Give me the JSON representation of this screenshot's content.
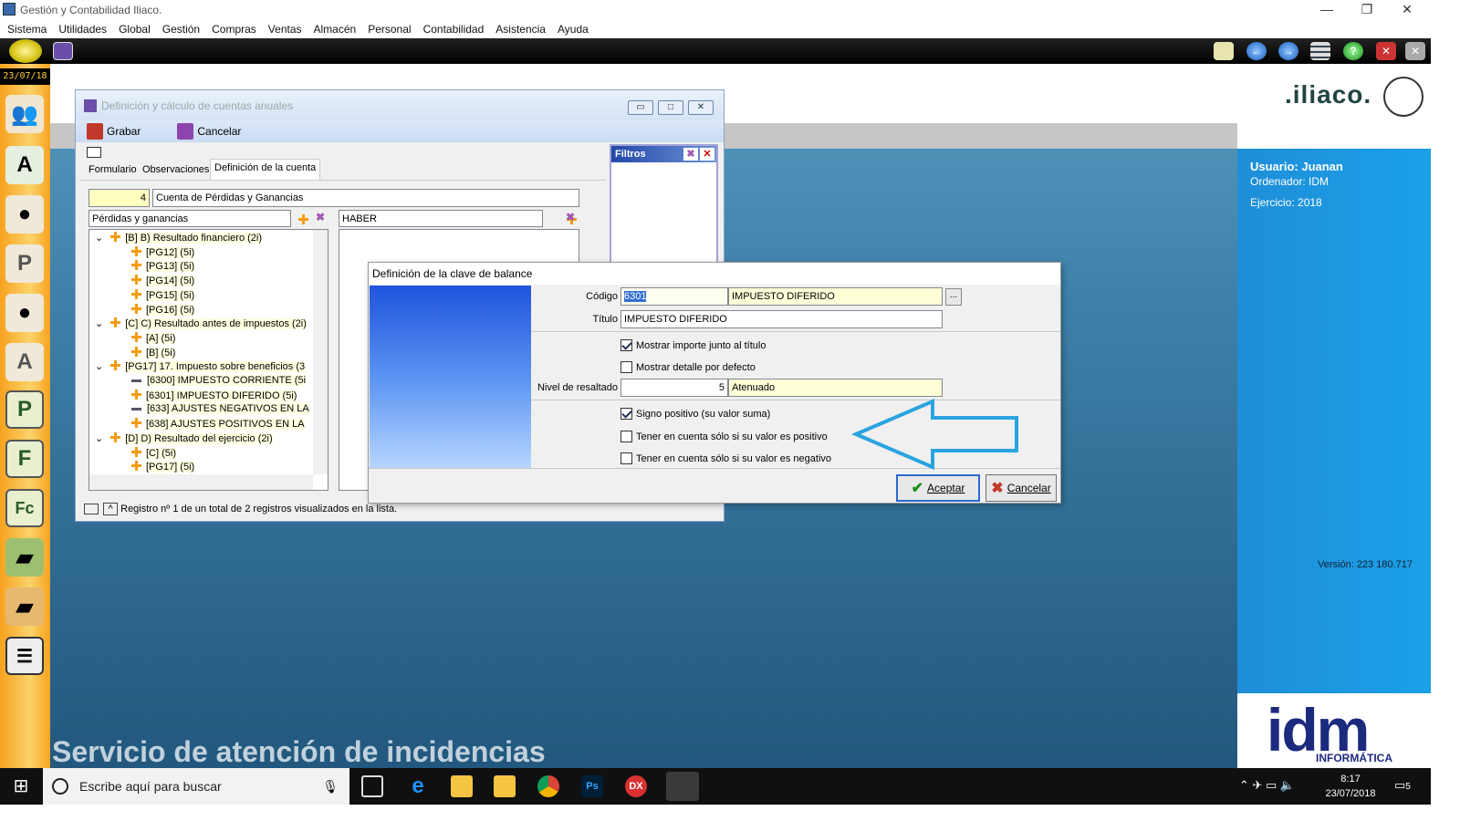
{
  "app": {
    "title": "Gestión y Contabilidad Iliaco.",
    "date": "23/07/18"
  },
  "menu": [
    "Sistema",
    "Utilidades",
    "Global",
    "Gestión",
    "Compras",
    "Ventas",
    "Almacén",
    "Personal",
    "Contabilidad",
    "Asistencia",
    "Ayuda"
  ],
  "window": {
    "title": "Definición y cálculo de cuentas anuales",
    "save_label": "Grabar",
    "cancel_label": "Cancelar",
    "tabs": [
      "Formulario",
      "Observaciones",
      "Definición de la cuenta"
    ],
    "account_number": "4",
    "account_name": "Cuenta de Pérdidas y Ganancias",
    "left_list_title": "Pérdidas y ganancias",
    "right_list_title": "HABER",
    "tree": [
      {
        "t": "[B] B) Resultado financiero (2i)",
        "lvl": 0,
        "icon": "plus",
        "exp": true
      },
      {
        "t": "[PG12] (5i)",
        "lvl": 1,
        "icon": "plus"
      },
      {
        "t": "[PG13] (5i)",
        "lvl": 1,
        "icon": "plus"
      },
      {
        "t": "[PG14] (5i)",
        "lvl": 1,
        "icon": "plus"
      },
      {
        "t": "[PG15] (5i)",
        "lvl": 1,
        "icon": "plus"
      },
      {
        "t": "[PG16] (5i)",
        "lvl": 1,
        "icon": "plus"
      },
      {
        "t": "[C] C) Resultado antes de impuestos (2i)",
        "lvl": 0,
        "icon": "plus",
        "exp": true
      },
      {
        "t": "[A] (5i)",
        "lvl": 1,
        "icon": "plus"
      },
      {
        "t": "[B] (5i)",
        "lvl": 1,
        "icon": "plus"
      },
      {
        "t": "[PG17] 17. Impuesto sobre beneficios (3",
        "lvl": 0,
        "icon": "plus",
        "exp": true
      },
      {
        "t": "[6300] IMPUESTO CORRIENTE (5i",
        "lvl": 1,
        "icon": "minus"
      },
      {
        "t": "[6301] IMPUESTO DIFERIDO (5i)",
        "lvl": 1,
        "icon": "plus"
      },
      {
        "t": "[633] AJUSTES NEGATIVOS EN LA",
        "lvl": 1,
        "icon": "minus"
      },
      {
        "t": "[638] AJUSTES POSITIVOS EN LA",
        "lvl": 1,
        "icon": "plus"
      },
      {
        "t": "[D] D) Resultado del ejercicio (2i)",
        "lvl": 0,
        "icon": "plus",
        "exp": true
      },
      {
        "t": "[C] (5i)",
        "lvl": 1,
        "icon": "plus"
      },
      {
        "t": "[PG17] (5i)",
        "lvl": 1,
        "icon": "plus"
      }
    ],
    "status": "Registro nº 1 de un total de 2 registros visualizados en la lista."
  },
  "filters": {
    "title": "Filtros"
  },
  "dialog": {
    "title": "Definición de la clave de balance",
    "code_label": "Código",
    "code_value": "6301",
    "code_desc": "IMPUESTO DIFERIDO",
    "title_label": "Título",
    "title_value": "IMPUESTO DIFERIDO",
    "chk_show_amount": "Mostrar importe junto al título",
    "chk_show_detail": "Mostrar detalle por defecto",
    "level_label": "Nivel de resaltado",
    "level_value": "5",
    "level_desc": "Atenuado",
    "chk_positive_sign": "Signo positivo (su valor suma)",
    "chk_only_positive": "Tener en cuenta sólo si su valor es positivo",
    "chk_only_negative": "Tener en cuenta sólo si su valor es negativo",
    "accept_label": "Aceptar",
    "cancel_label": "Cancelar",
    "browse_label": "..."
  },
  "info": {
    "user": "Usuario: Juanan",
    "computer": "Ordenador: IDM",
    "year": "Ejercicio: 2018",
    "version": "Versión: 223 180.717"
  },
  "branding": {
    "logo": ".iliaco.",
    "idm": "idm",
    "idm_sub": "INFORMÁTICA",
    "service": "Servicio de atención de incidencias"
  },
  "taskbar": {
    "search": "Escribe aquí para buscar",
    "time": "8:17",
    "date": "23/07/2018",
    "notif": "5"
  }
}
